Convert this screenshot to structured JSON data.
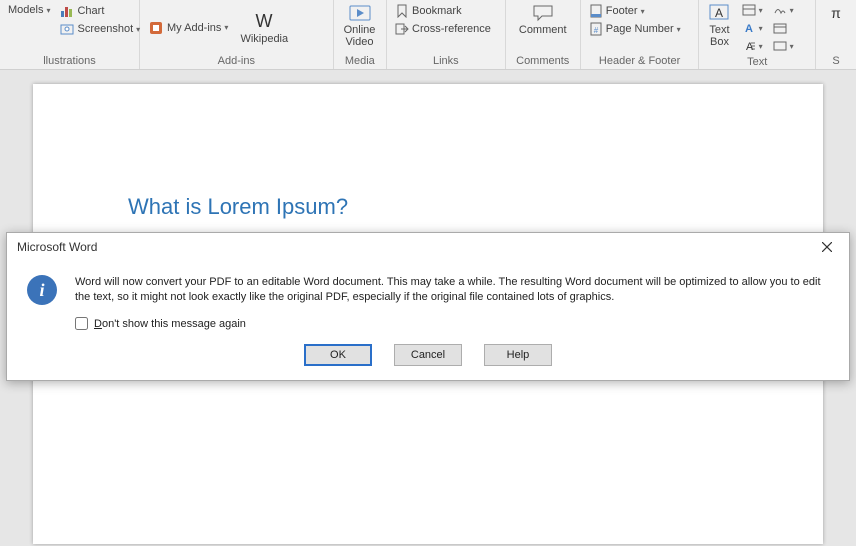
{
  "ribbon": {
    "illustrations": {
      "models": "Models",
      "chart": "Chart",
      "screenshot": "Screenshot",
      "label": "llustrations"
    },
    "addins": {
      "my_addins": "My Add-ins",
      "wikipedia": "Wikipedia",
      "label": "Add-ins"
    },
    "media": {
      "online_video": "Online\nVideo",
      "label": "Media"
    },
    "links": {
      "bookmark": "Bookmark",
      "crossref": "Cross-reference",
      "label": "Links"
    },
    "comments": {
      "comment": "Comment",
      "label": "Comments"
    },
    "headerfooter": {
      "footer": "Footer",
      "pagenum": "Page Number",
      "label": "Header & Footer"
    },
    "text": {
      "textbox": "Text\nBox",
      "label": "Text"
    }
  },
  "document": {
    "heading": "What is Lorem Ipsum?"
  },
  "dialog": {
    "title": "Microsoft Word",
    "message": "Word will now convert your PDF to an editable Word document. This may take a while. The resulting Word document will be optimized to allow you to edit the text, so it might not look exactly like the original PDF, especially if the original file contained lots of graphics.",
    "checkbox_prefix": "D",
    "checkbox_rest": "on't show this message again",
    "ok": "OK",
    "cancel": "Cancel",
    "help_prefix": "H",
    "help_rest": "elp"
  }
}
